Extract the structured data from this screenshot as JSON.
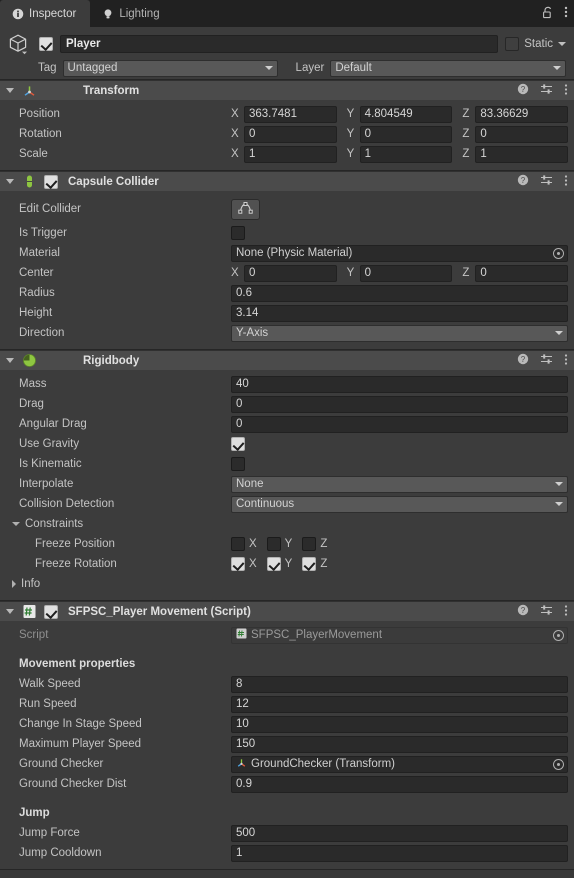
{
  "window": {
    "tabs": [
      {
        "label": "Inspector",
        "icon": "info-icon",
        "active": true
      },
      {
        "label": "Lighting",
        "icon": "lightbulb-icon",
        "active": false
      }
    ],
    "lock_icon": "lock-open-icon",
    "menu_icon": "kebab-menu-icon"
  },
  "object_header": {
    "icon": "gameobject-cube-icon",
    "enabled": true,
    "name": "Player",
    "static_label": "Static",
    "static_checked": false,
    "tag_label": "Tag",
    "tag_value": "Untagged",
    "layer_label": "Layer",
    "layer_value": "Default"
  },
  "header_icons": {
    "help": "help-icon",
    "preset": "preset-sliders-icon",
    "menu": "kebab-menu-icon"
  },
  "components": [
    {
      "id": "transform",
      "title": "Transform",
      "icon": "transform-axis-icon",
      "has_checkbox": false,
      "expanded": true,
      "rows": [
        {
          "type": "vector3",
          "label": "Position",
          "x": "363.7481",
          "y": "4.804549",
          "z": "83.36629"
        },
        {
          "type": "vector3",
          "label": "Rotation",
          "x": "0",
          "y": "0",
          "z": "0"
        },
        {
          "type": "vector3",
          "label": "Scale",
          "x": "1",
          "y": "1",
          "z": "1"
        }
      ]
    },
    {
      "id": "capsule-collider",
      "title": "Capsule Collider",
      "icon": "capsule-collider-icon",
      "has_checkbox": true,
      "checked": true,
      "expanded": true,
      "rows": [
        {
          "type": "button",
          "label": "Edit Collider",
          "button_icon": "edit-collider-icon"
        },
        {
          "type": "checkbox",
          "label": "Is Trigger",
          "checked": false
        },
        {
          "type": "object",
          "label": "Material",
          "value": "None (Physic Material)",
          "value_icon": null
        },
        {
          "type": "vector3",
          "label": "Center",
          "x": "0",
          "y": "0",
          "z": "0"
        },
        {
          "type": "text",
          "label": "Radius",
          "value": "0.6"
        },
        {
          "type": "text",
          "label": "Height",
          "value": "3.14"
        },
        {
          "type": "popup",
          "label": "Direction",
          "value": "Y-Axis"
        }
      ]
    },
    {
      "id": "rigidbody",
      "title": "Rigidbody",
      "icon": "rigidbody-icon",
      "has_checkbox": false,
      "expanded": true,
      "rows": [
        {
          "type": "text",
          "label": "Mass",
          "value": "40"
        },
        {
          "type": "text",
          "label": "Drag",
          "value": "0"
        },
        {
          "type": "text",
          "label": "Angular Drag",
          "value": "0"
        },
        {
          "type": "checkbox",
          "label": "Use Gravity",
          "checked": true
        },
        {
          "type": "checkbox",
          "label": "Is Kinematic",
          "checked": false
        },
        {
          "type": "popup",
          "label": "Interpolate",
          "value": "None"
        },
        {
          "type": "popup",
          "label": "Collision Detection",
          "value": "Continuous"
        },
        {
          "type": "foldout",
          "label": "Constraints",
          "expanded": true
        },
        {
          "type": "axis-checkboxes",
          "label": "Freeze Position",
          "axes": [
            "X",
            "Y",
            "Z"
          ],
          "checked": [
            false,
            false,
            false
          ]
        },
        {
          "type": "axis-checkboxes",
          "label": "Freeze Rotation",
          "axes": [
            "X",
            "Y",
            "Z"
          ],
          "checked": [
            true,
            true,
            true
          ]
        },
        {
          "type": "foldout",
          "label": "Info",
          "expanded": false
        }
      ]
    },
    {
      "id": "player-movement-script",
      "title": "SFPSC_Player Movement (Script)",
      "icon": "csharp-script-icon",
      "has_checkbox": true,
      "checked": true,
      "expanded": true,
      "rows": [
        {
          "type": "object-disabled",
          "label": "Script",
          "value": "SFPSC_PlayerMovement",
          "value_icon": "script-asset-icon"
        },
        {
          "type": "spacer"
        },
        {
          "type": "heading",
          "label": "Movement properties"
        },
        {
          "type": "text",
          "label": "Walk Speed",
          "value": "8"
        },
        {
          "type": "text",
          "label": "Run Speed",
          "value": "12"
        },
        {
          "type": "text",
          "label": "Change In Stage Speed",
          "value": "10"
        },
        {
          "type": "text",
          "label": "Maximum Player Speed",
          "value": "150"
        },
        {
          "type": "object",
          "label": "Ground Checker",
          "value": "GroundChecker (Transform)",
          "value_icon": "transform-axis-icon"
        },
        {
          "type": "text",
          "label": "Ground Checker Dist",
          "value": "0.9"
        },
        {
          "type": "spacer"
        },
        {
          "type": "heading",
          "label": "Jump"
        },
        {
          "type": "text",
          "label": "Jump Force",
          "value": "500"
        },
        {
          "type": "text",
          "label": "Jump Cooldown",
          "value": "1"
        }
      ]
    }
  ],
  "colors": {
    "background": "#383838",
    "panel": "#3c3c3c",
    "component_header": "#4b4b4b",
    "tabbar": "#212121",
    "field": "#2a2a2a",
    "popup": "#585858",
    "text": "#c4c4c4",
    "unity_green": "#8ec641"
  }
}
